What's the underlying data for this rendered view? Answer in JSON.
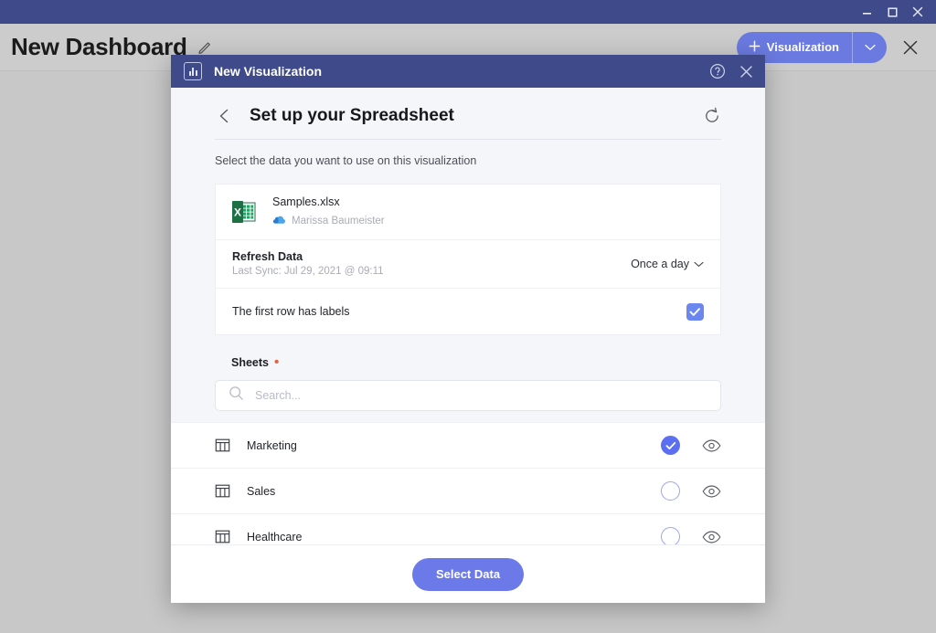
{
  "window": {
    "minimize_label": "Minimize",
    "maximize_label": "Maximize",
    "close_label": "Close"
  },
  "app_header": {
    "dashboard_title": "New Dashboard",
    "edit_icon": "pencil-icon",
    "visualization_button": {
      "label": "Visualization",
      "plus_icon": "plus-icon",
      "caret_icon": "chevron-down-icon",
      "color": "#6b7ae0"
    },
    "close_icon": "close-icon"
  },
  "modal": {
    "header": {
      "icon": "bar-chart-icon",
      "title": "New Visualization",
      "help_icon": "question-circle-icon",
      "close_icon": "close-icon",
      "bar_color": "#3f4a8a"
    },
    "setup": {
      "back_icon": "arrow-left-icon",
      "title": "Set up your Spreadsheet",
      "refresh_icon": "refresh-icon",
      "subtitle": "Select the data you want to use on this visualization"
    },
    "file": {
      "icon": "excel-file-icon",
      "name": "Samples.xlsx",
      "cloud_icon": "onedrive-cloud-icon",
      "owner": "Marissa Baumeister"
    },
    "refresh_data": {
      "label": "Refresh Data",
      "last_sync": "Last Sync: Jul 29, 2021 @ 09:11",
      "frequency_value": "Once a day",
      "frequency_caret": "chevron-down-icon"
    },
    "first_row_labels": {
      "label": "The first row has labels",
      "checked": true,
      "check_color": "#6b86ef"
    },
    "sheets_section": {
      "label": "Sheets",
      "required_marker": "•",
      "search_placeholder": "Search...",
      "search_value": "",
      "search_icon": "search-icon",
      "rows": [
        {
          "name": "Marketing",
          "icon": "table-icon",
          "selected": true,
          "preview_icon": "eye-icon"
        },
        {
          "name": "Sales",
          "icon": "table-icon",
          "selected": false,
          "preview_icon": "eye-icon"
        },
        {
          "name": "Healthcare",
          "icon": "table-icon",
          "selected": false,
          "preview_icon": "eye-icon"
        }
      ]
    },
    "footer": {
      "submit_label": "Select Data",
      "submit_color": "#6b7ae8"
    }
  }
}
